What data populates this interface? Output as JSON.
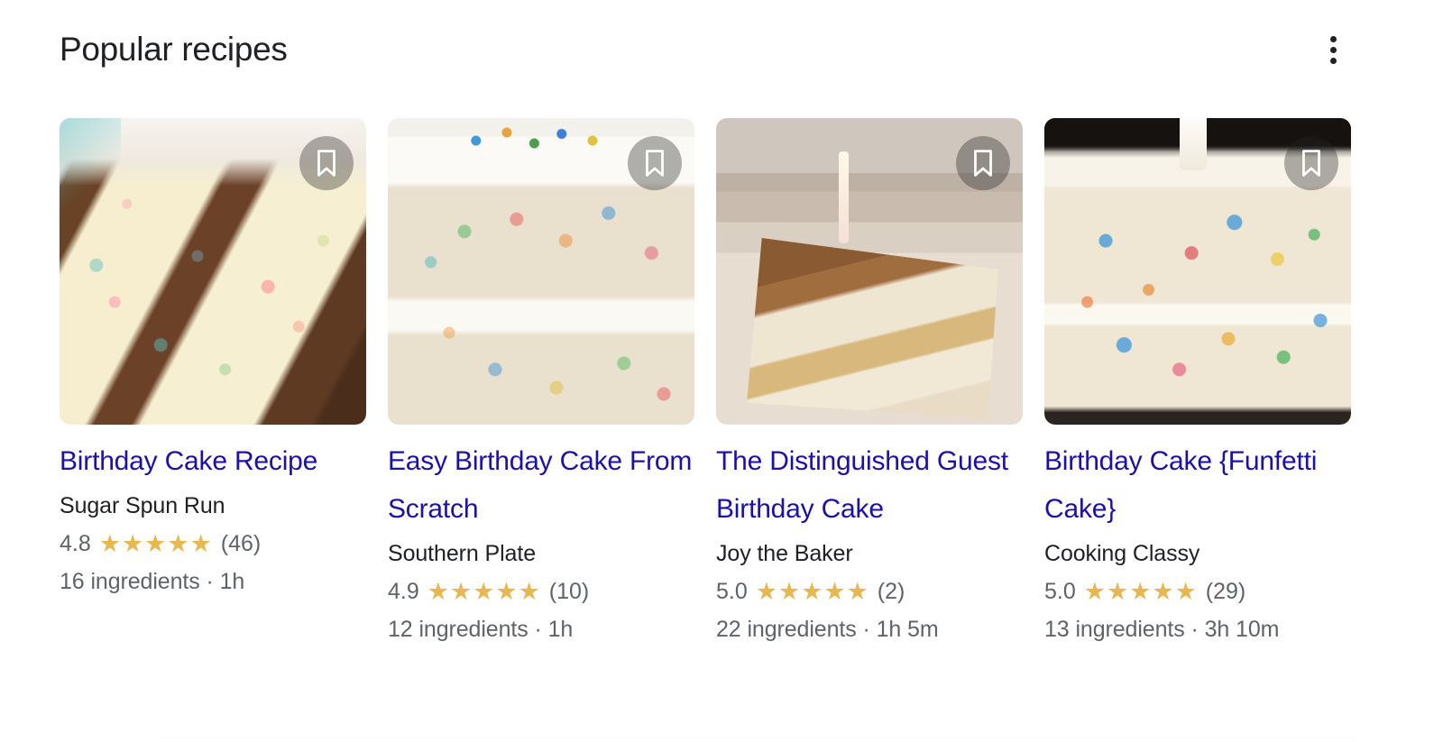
{
  "header": {
    "title": "Popular recipes",
    "overflow_menu_name": "more-options"
  },
  "cards": [
    {
      "title": "Birthday Cake Recipe",
      "source": "Sugar Spun Run",
      "rating": "4.8",
      "stars": "★★★★★",
      "rating_count": "(46)",
      "meta": "16 ingredients · 1h",
      "bookmark_label": "Save",
      "image_alt": "funfetti-cake-slice-with-chocolate-frosting"
    },
    {
      "title": "Easy Birthday Cake From Scratch",
      "source": "Southern Plate",
      "rating": "4.9",
      "stars": "★★★★★",
      "rating_count": "(10)",
      "meta": "12 ingredients · 1h",
      "bookmark_label": "Save",
      "image_alt": "white-frosted-funfetti-layer-cake"
    },
    {
      "title": "The Distinguished Guest Birthday Cake",
      "source": "Joy the Baker",
      "rating": "5.0",
      "stars": "★★★★★",
      "rating_count": "(2)",
      "meta": "22 ingredients · 1h 5m",
      "bookmark_label": "Save",
      "image_alt": "chocolate-cake-slice-with-lit-candle"
    },
    {
      "title": "Birthday Cake {Funfetti Cake}",
      "source": "Cooking Classy",
      "rating": "5.0",
      "stars": "★★★★★",
      "rating_count": "(29)",
      "meta": "13 ingredients · 3h 10m",
      "bookmark_label": "Save",
      "image_alt": "white-funfetti-cake-with-sprinkles"
    }
  ],
  "colors": {
    "link": "#1b11a8",
    "title_text": "#202124",
    "secondary_text": "#5f6368",
    "star": "#e7b84f",
    "background": "#ffffff"
  }
}
